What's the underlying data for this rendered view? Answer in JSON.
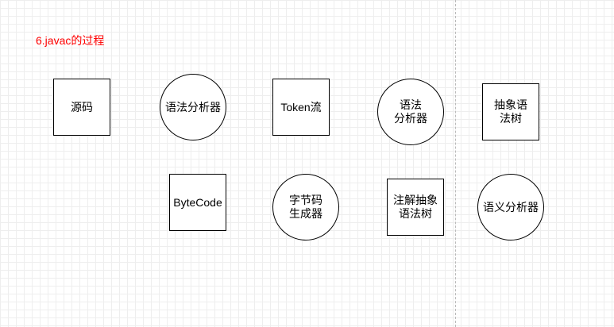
{
  "diagram": {
    "title": "6.javac的过程",
    "title_color": "#ff0000",
    "nodes": [
      {
        "label": "源码",
        "shape": "rectangle"
      },
      {
        "label": "语法分析器",
        "shape": "circle"
      },
      {
        "label": "Token流",
        "shape": "rectangle"
      },
      {
        "label": "语法\n分析器",
        "shape": "circle"
      },
      {
        "label": "抽象语\n法树",
        "shape": "rectangle"
      },
      {
        "label": "ByteCode",
        "shape": "rectangle"
      },
      {
        "label": "字节码\n生成器",
        "shape": "circle"
      },
      {
        "label": "注解抽象\n语法树",
        "shape": "rectangle"
      },
      {
        "label": "语义分析器",
        "shape": "circle"
      }
    ]
  }
}
